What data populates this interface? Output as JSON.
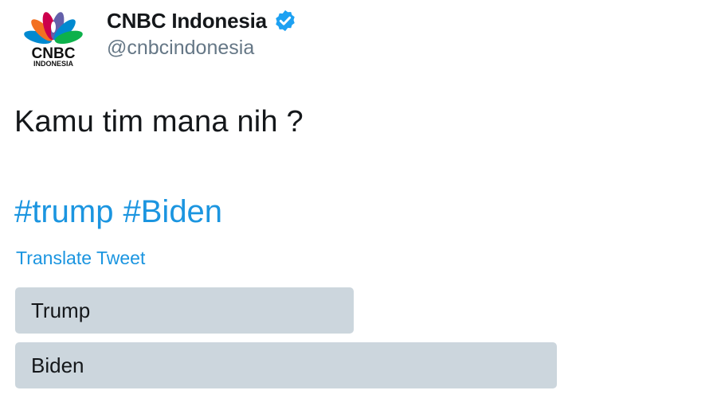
{
  "author": {
    "display_name": "CNBC Indonesia",
    "handle": "@cnbcindonesia",
    "verified": true,
    "avatar_logo": {
      "wordmark": "CNBC",
      "subtitle": "INDONESIA",
      "icon": "cnbc-peacock-logo"
    }
  },
  "tweet": {
    "text": "Kamu tim mana nih ?",
    "hashtags": [
      "#trump",
      "#Biden"
    ],
    "translate_label": "Translate Tweet"
  },
  "poll": {
    "options": [
      {
        "label": "Trump"
      },
      {
        "label": "Biden"
      }
    ]
  },
  "colors": {
    "link": "#1b95e0",
    "text": "#14171a",
    "secondary": "#657786",
    "poll_fill": "#ccd6dd",
    "verified_badge": "#1da1f2"
  }
}
